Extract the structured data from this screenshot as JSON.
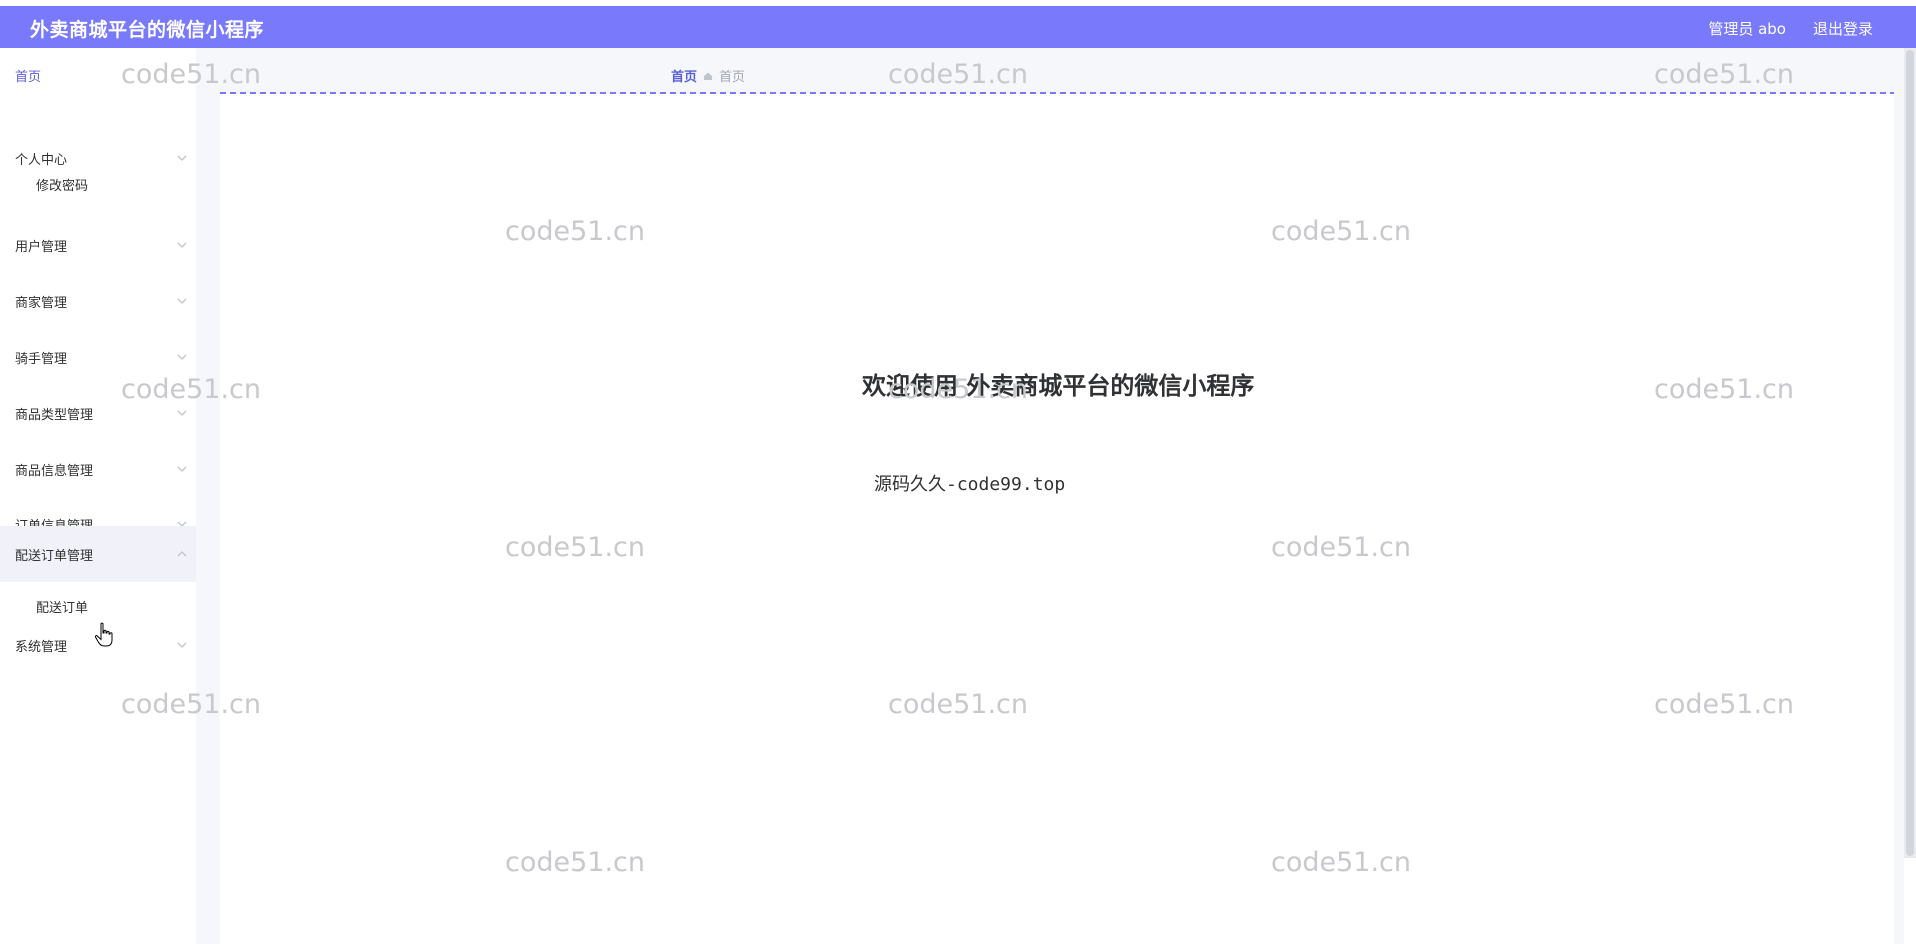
{
  "app": {
    "title": "外卖商城平台的微信小程序",
    "user": "管理员 abo",
    "logout": "退出登录",
    "accent": "#7879fb"
  },
  "sidebar": {
    "home": "首页",
    "items": [
      {
        "label": "个人中心",
        "sub": "修改密码"
      },
      {
        "label": "用户管理"
      },
      {
        "label": "商家管理"
      },
      {
        "label": "骑手管理"
      },
      {
        "label": "商品类型管理"
      },
      {
        "label": "商品信息管理"
      },
      {
        "label": "订单信息管理"
      },
      {
        "label": "配送订单管理",
        "sub": "配送订单",
        "active": true
      },
      {
        "label": "系统管理"
      }
    ]
  },
  "breadcrumb": {
    "first": "首页",
    "second": "首页"
  },
  "main": {
    "welcome": "欢迎使用 外卖商城平台的微信小程序",
    "source": "源码久久-code99.top"
  },
  "watermark": "code51.cn"
}
